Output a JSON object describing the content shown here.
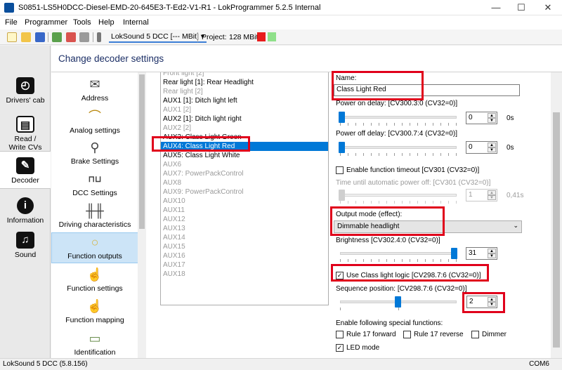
{
  "window": {
    "title": "S0851-LS5H0DCC-Diesel-EMD-20-645E3-T-Ed2-V1-R1 - LokProgrammer 5.2.5 Internal",
    "minimize": "—",
    "maximize": "☐",
    "close": "✕"
  },
  "menu": [
    "File",
    "Programmer",
    "Tools",
    "Help",
    "Internal"
  ],
  "toolbar": {
    "decoder": "LokSound 5 DCC [--- MBit]",
    "project_label": "Project:",
    "project_size": "128 MBit",
    "status_colors": [
      "#e81c1c",
      "#8fe08a"
    ]
  },
  "main_nav": [
    {
      "label": "Drivers' cab",
      "icon": "speedometer-icon"
    },
    {
      "label": "Read / Write CVs",
      "icon": "cv-icon"
    },
    {
      "label": "Decoder",
      "icon": "wrench-icon"
    },
    {
      "label": "Information",
      "icon": "info-icon"
    },
    {
      "label": "Sound",
      "icon": "music-icon"
    }
  ],
  "header": {
    "title": "Change decoder settings"
  },
  "categories": [
    {
      "label": "Address",
      "icon": "envelope-icon"
    },
    {
      "label": "Analog settings",
      "icon": "analog-icon"
    },
    {
      "label": "Brake Settings",
      "icon": "brake-icon"
    },
    {
      "label": "DCC Settings",
      "icon": "dcc-icon"
    },
    {
      "label": "Driving characteristics",
      "icon": "driving-icon"
    },
    {
      "label": "Function outputs",
      "icon": "lightbulb-icon"
    },
    {
      "label": "Function settings",
      "icon": "function-settings-icon"
    },
    {
      "label": "Function mapping",
      "icon": "function-mapping-icon"
    },
    {
      "label": "Identification",
      "icon": "id-card-icon"
    }
  ],
  "outputs": [
    {
      "label": "Front light [2]",
      "state": "dim"
    },
    {
      "label": "Rear light [1]: Rear Headlight",
      "state": "normal"
    },
    {
      "label": "Rear light [2]",
      "state": "dim"
    },
    {
      "label": "AUX1 [1]: Ditch light left",
      "state": "normal"
    },
    {
      "label": "AUX1 [2]",
      "state": "dim"
    },
    {
      "label": "AUX2 [1]: Ditch light right",
      "state": "normal"
    },
    {
      "label": "AUX2 [2]",
      "state": "dim"
    },
    {
      "label": "AUX3: Class Light Green",
      "state": "normal"
    },
    {
      "label": "AUX4: Class Light Red",
      "state": "selected"
    },
    {
      "label": "AUX5: Class Light White",
      "state": "normal"
    },
    {
      "label": "AUX6",
      "state": "dim"
    },
    {
      "label": "AUX7: PowerPackControl",
      "state": "dim"
    },
    {
      "label": "AUX8",
      "state": "dim"
    },
    {
      "label": "AUX9: PowerPackControl",
      "state": "dim"
    },
    {
      "label": "AUX10",
      "state": "dim"
    },
    {
      "label": "AUX11",
      "state": "dim"
    },
    {
      "label": "AUX12",
      "state": "dim"
    },
    {
      "label": "AUX13",
      "state": "dim"
    },
    {
      "label": "AUX14",
      "state": "dim"
    },
    {
      "label": "AUX15",
      "state": "dim"
    },
    {
      "label": "AUX16",
      "state": "dim"
    },
    {
      "label": "AUX17",
      "state": "dim"
    },
    {
      "label": "AUX18",
      "state": "dim"
    }
  ],
  "settings": {
    "name_label": "Name:",
    "name_value": "Class Light Red",
    "power_on_label": "Power on delay: [CV300.3:0 (CV32=0)]",
    "power_on_value": "0",
    "power_on_unit": "0s",
    "power_on_level": 0,
    "power_off_label": "Power off delay: [CV300.7:4 (CV32=0)]",
    "power_off_value": "0",
    "power_off_unit": "0s",
    "power_off_level": 0,
    "timeout_label": "Enable function timeout [CV301 (CV32=0)]",
    "timeout_checked": false,
    "auto_off_label": "Time until automatic power off: [CV301 (CV32=0)]",
    "auto_off_value": "1",
    "auto_off_unit": "0,41s",
    "auto_off_level": 0,
    "mode_label": "Output mode (effect):",
    "mode_value": "Dimmable headlight",
    "brightness_label": "Brightness [CV302.4:0 (CV32=0)]",
    "brightness_value": "31",
    "brightness_level": 1,
    "class_logic_label": "Use Class light logic [CV298.7:6 (CV32=0)]",
    "class_logic_checked": true,
    "sequence_label": "Sequence position: [CV298.7:6 (CV32=0)]",
    "sequence_value": "2",
    "sequence_level": 0.5,
    "special_label": "Enable following special functions:",
    "rule17_fwd": "Rule 17 forward",
    "rule17_rev": "Rule 17 reverse",
    "dimmer": "Dimmer",
    "led_mode": "LED mode",
    "led_checked": true,
    "check_mark": "✓"
  },
  "statusbar": {
    "left": "LokSound 5 DCC (5.8.156)",
    "right": "COM6"
  }
}
